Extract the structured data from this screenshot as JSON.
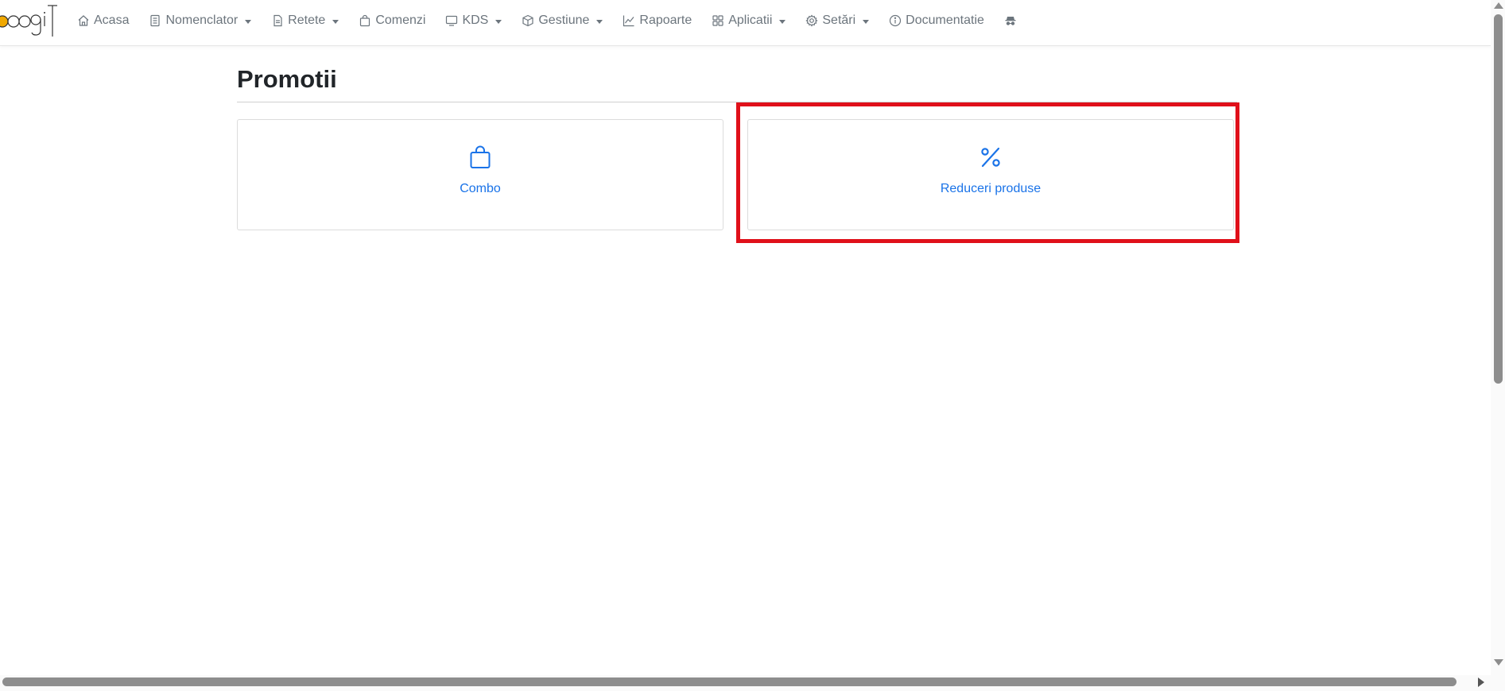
{
  "brand": {
    "logo_text": "oogiT",
    "logo_dot_color": "#f0a800"
  },
  "nav": {
    "items": [
      {
        "label": "Acasa",
        "icon": "house-icon",
        "dropdown": false
      },
      {
        "label": "Nomenclator",
        "icon": "list-book-icon",
        "dropdown": true
      },
      {
        "label": "Retete",
        "icon": "document-icon",
        "dropdown": true
      },
      {
        "label": "Comenzi",
        "icon": "shopping-bag-icon",
        "dropdown": false
      },
      {
        "label": "KDS",
        "icon": "monitor-icon",
        "dropdown": true
      },
      {
        "label": "Gestiune",
        "icon": "box-icon",
        "dropdown": true
      },
      {
        "label": "Rapoarte",
        "icon": "line-chart-icon",
        "dropdown": false
      },
      {
        "label": "Aplicatii",
        "icon": "grid-icon",
        "dropdown": true
      },
      {
        "label": "Setări",
        "icon": "gear-icon",
        "dropdown": true
      },
      {
        "label": "Documentatie",
        "icon": "info-circle-icon",
        "dropdown": false
      },
      {
        "label": "",
        "icon": "incognito-icon",
        "dropdown": false
      }
    ]
  },
  "page": {
    "title": "Promotii"
  },
  "cards": [
    {
      "label": "Combo",
      "icon": "shopping-bag-icon"
    },
    {
      "label": "Reduceri produse",
      "icon": "percent-icon"
    }
  ],
  "colors": {
    "accent": "#1a73e8",
    "highlight": "#e0101a",
    "nav_text": "#6c757d"
  }
}
